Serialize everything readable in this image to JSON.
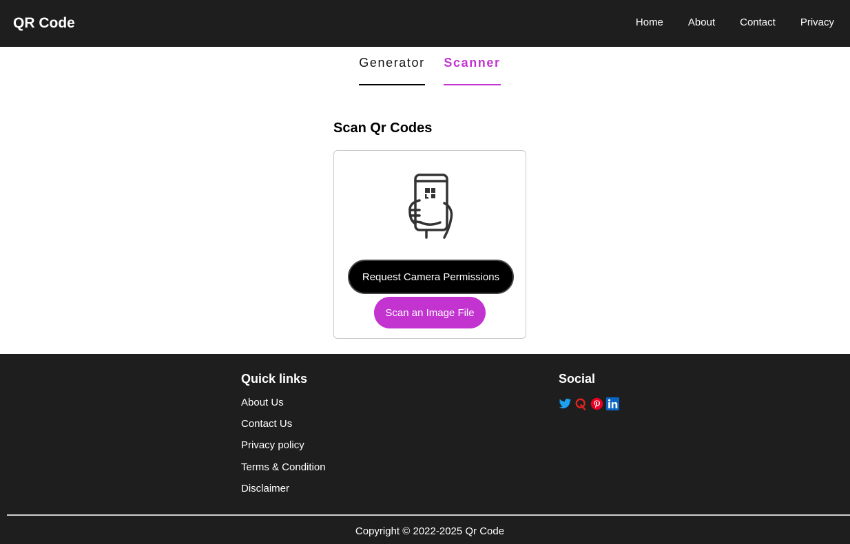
{
  "header": {
    "brand": "QR Code",
    "nav": [
      {
        "label": "Home"
      },
      {
        "label": "About"
      },
      {
        "label": "Contact"
      },
      {
        "label": "Privacy"
      }
    ]
  },
  "tabs": [
    {
      "label": "Generator",
      "active": false
    },
    {
      "label": "Scanner",
      "active": true
    }
  ],
  "main": {
    "title": "Scan Qr Codes",
    "icon": "phone-qr-scan-icon",
    "request_camera_label": "Request Camera Permissions",
    "scan_file_label": "Scan an Image File"
  },
  "footer": {
    "quick_links_title": "Quick links",
    "quick_links": [
      "About Us",
      "Contact Us",
      "Privacy policy",
      "Terms & Condition",
      "Disclaimer"
    ],
    "social_title": "Social",
    "social": [
      {
        "icon": "twitter-icon",
        "color": "#1da1f2"
      },
      {
        "icon": "quora-icon",
        "color": "#e0231f"
      },
      {
        "icon": "pinterest-icon",
        "color": "#e60023"
      },
      {
        "icon": "linkedin-icon",
        "color": "#0a66c2"
      }
    ],
    "copyright": "Copyright © 2022-2025 Qr Code"
  },
  "colors": {
    "header_bg": "#1e1e1e",
    "accent": "#c233d0",
    "footer_bg": "#1e1e1e"
  }
}
